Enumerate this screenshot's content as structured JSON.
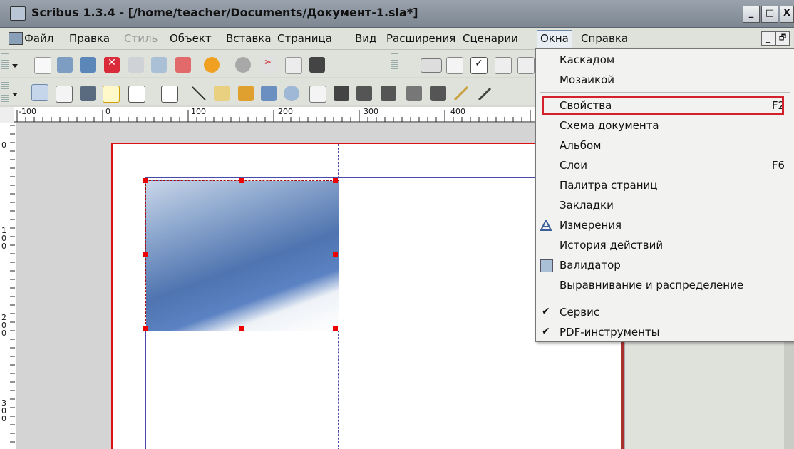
{
  "window": {
    "title": "Scribus 1.3.4 - [/home/teacher/Documents/Документ-1.sla*]",
    "btn_min": "_",
    "btn_max": "□",
    "btn_close": "X"
  },
  "menubar": {
    "items": [
      {
        "label": "Файл"
      },
      {
        "label": "Правка"
      },
      {
        "label": "Стиль"
      },
      {
        "label": "Объект"
      },
      {
        "label": "Вставка"
      },
      {
        "label": "Страница"
      },
      {
        "label": "Вид"
      },
      {
        "label": "Расширения"
      },
      {
        "label": "Сценарии"
      },
      {
        "label": "Окна"
      },
      {
        "label": "Справка"
      }
    ],
    "mdi_min": "_",
    "mdi_restore": "🗗"
  },
  "ruler": {
    "h_labels": [
      "-100",
      "0",
      "100",
      "200",
      "300",
      "400"
    ],
    "v_labels": [
      "0",
      "1\n0\n0",
      "2\n0\n0",
      "3\n0\n0"
    ]
  },
  "okna_menu": {
    "items": [
      {
        "label": "Каскадом",
        "shortcut": ""
      },
      {
        "label": "Мозаикой",
        "shortcut": ""
      },
      {
        "label": "Свойства",
        "shortcut": "F2"
      },
      {
        "label": "Схема документа",
        "shortcut": ""
      },
      {
        "label": "Альбом",
        "shortcut": ""
      },
      {
        "label": "Слои",
        "shortcut": "F6"
      },
      {
        "label": "Палитра страниц",
        "shortcut": ""
      },
      {
        "label": "Закладки",
        "shortcut": ""
      },
      {
        "label": "Измерения",
        "shortcut": ""
      },
      {
        "label": "История действий",
        "shortcut": ""
      },
      {
        "label": "Валидатор",
        "shortcut": ""
      },
      {
        "label": "Выравнивание и распределение",
        "shortcut": ""
      },
      {
        "label": "Сервис",
        "shortcut": ""
      },
      {
        "label": "PDF-инструменты",
        "shortcut": ""
      }
    ],
    "check": "✔",
    "highlighted": "Свойства"
  }
}
